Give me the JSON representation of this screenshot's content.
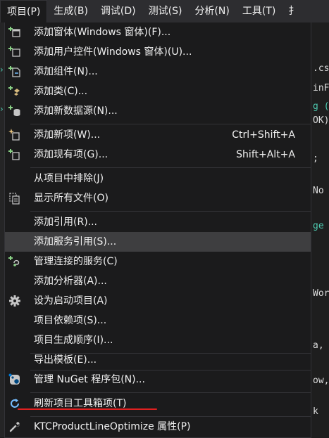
{
  "menubar": [
    "项目(P)",
    "生成(B)",
    "调试(D)",
    "测试(S)",
    "分析(N)",
    "工具(T)",
    "扌"
  ],
  "menu": {
    "items": [
      {
        "label": "添加窗体(Windows 窗体)(F)...",
        "icon": "add-form-icon"
      },
      {
        "label": "添加用户控件(Windows 窗体)(U)...",
        "icon": "add-user-control-icon"
      },
      {
        "label": "添加组件(N)...",
        "icon": "add-component-icon"
      },
      {
        "label": "添加类(C)...",
        "icon": "add-class-icon"
      },
      {
        "label": "添加新数据源(N)...",
        "icon": "add-data-source-icon"
      },
      {
        "label": "添加新项(W)...",
        "shortcut": "Ctrl+Shift+A",
        "icon": "add-new-item-icon"
      },
      {
        "label": "添加现有项(G)...",
        "shortcut": "Shift+Alt+A",
        "icon": "add-existing-item-icon"
      },
      {
        "label": "从项目中排除(J)"
      },
      {
        "label": "显示所有文件(O)",
        "icon": "show-all-files-icon"
      },
      {
        "label": "添加引用(R)..."
      },
      {
        "label": "添加服务引用(S)..."
      },
      {
        "label": "管理连接的服务(C)",
        "icon": "connected-services-icon"
      },
      {
        "label": "添加分析器(A)..."
      },
      {
        "label": "设为启动项目(A)",
        "icon": "gear-icon"
      },
      {
        "label": "项目依赖项(S)..."
      },
      {
        "label": "项目生成顺序(I)..."
      },
      {
        "label": "导出模板(E)..."
      },
      {
        "label": "管理 NuGet 程序包(N)...",
        "icon": "nuget-icon"
      },
      {
        "label": "刷新项目工具箱项(T)",
        "icon": "refresh-icon"
      },
      {
        "label": "KTCProductLineOptimize 属性(P)",
        "icon": "wrench-icon"
      }
    ]
  },
  "background": {
    "code_fragments": [
      ".cs",
      "inF",
      "g (",
      "OK)",
      ";",
      "No",
      "ge (",
      "Wor",
      "a,",
      "ow,",
      "k"
    ]
  },
  "colors": {
    "menu_bg": "#1b1b1c",
    "hover_bg": "#3e3e40",
    "menubar_bg": "#2d2d30",
    "annotation": "#e02020"
  }
}
